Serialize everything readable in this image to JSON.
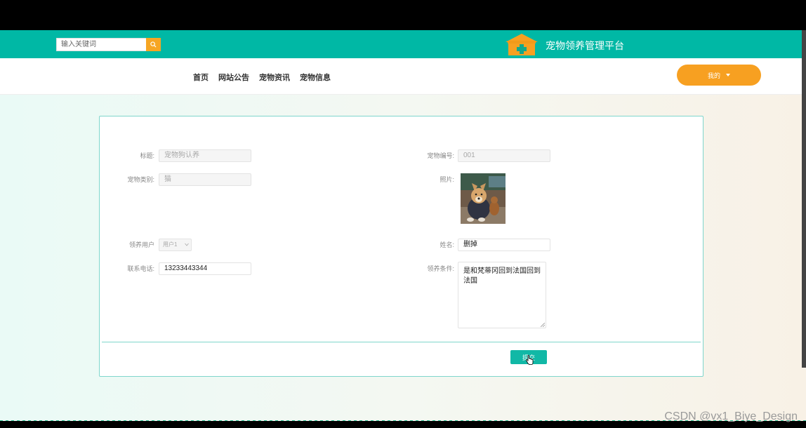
{
  "header": {
    "search_placeholder": "输入关键词",
    "site_title": "宠物领养管理平台"
  },
  "nav": {
    "items": [
      "首页",
      "网站公告",
      "宠物资讯",
      "宠物信息"
    ],
    "my_label": "我的"
  },
  "form": {
    "title_label": "标题:",
    "title_value": "宠物狗认养",
    "pet_no_label": "宠物编号:",
    "pet_no_value": "001",
    "pet_type_label": "宠物类别:",
    "pet_type_value": "猫",
    "photo_label": "照片:",
    "adopter_label": "领养用户",
    "adopter_value": "用户1",
    "name_label": "姓名:",
    "name_value": "删掉",
    "phone_label": "联系电话:",
    "phone_value": "13233443344",
    "conditions_label": "领养条件:",
    "conditions_value": "是和梵蒂冈回到法国回到法国",
    "submit_label": "提交"
  },
  "watermark": "CSDN @vx1_Biye_Design",
  "colors": {
    "topbar": "#00b8a5",
    "accent_orange": "#f7a021",
    "submit": "#11b8a6"
  }
}
